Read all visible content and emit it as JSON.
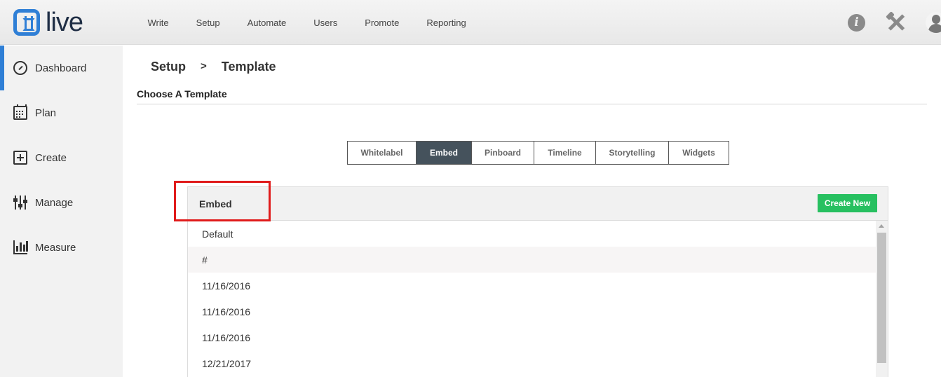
{
  "app": {
    "logo_text": "live",
    "brand_color": "#2f7fd6"
  },
  "topnav": {
    "items": [
      "Write",
      "Setup",
      "Automate",
      "Users",
      "Promote",
      "Reporting"
    ]
  },
  "top_icons": {
    "info": "info-icon",
    "tools": "tools-icon",
    "user": "user-icon"
  },
  "sidebar": {
    "items": [
      {
        "label": "Dashboard",
        "icon": "dashboard-icon",
        "active": true
      },
      {
        "label": "Plan",
        "icon": "calendar-icon"
      },
      {
        "label": "Create",
        "icon": "plus-square-icon"
      },
      {
        "label": "Manage",
        "icon": "sliders-icon"
      },
      {
        "label": "Measure",
        "icon": "bar-chart-icon"
      }
    ]
  },
  "breadcrumb": {
    "parent": "Setup",
    "separator": ">",
    "current": "Template"
  },
  "section_title": "Choose A Template",
  "tabs": [
    {
      "label": "Whitelabel"
    },
    {
      "label": "Embed",
      "active": true
    },
    {
      "label": "Pinboard"
    },
    {
      "label": "Timeline"
    },
    {
      "label": "Storytelling"
    },
    {
      "label": "Widgets"
    }
  ],
  "panel": {
    "title": "Embed",
    "create_button": "Create New",
    "button_color": "#27c060",
    "rows": [
      "Default",
      "#",
      "11/16/2016",
      "11/16/2016",
      "11/16/2016",
      "12/21/2017"
    ]
  },
  "annotation": {
    "highlight_color": "#e01b1b"
  }
}
